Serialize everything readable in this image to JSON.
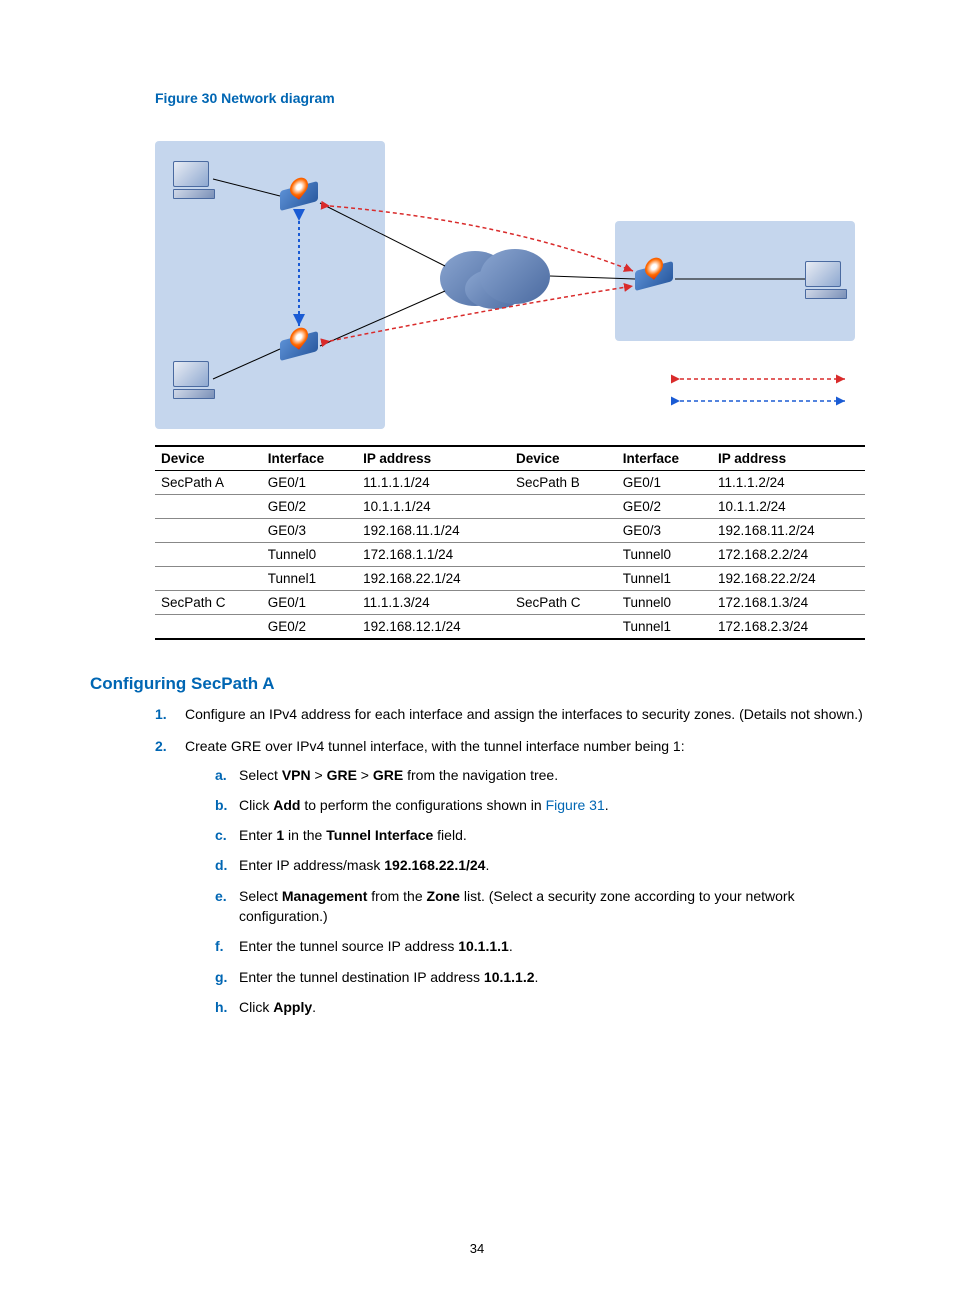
{
  "figure_caption": "Figure 30 Network diagram",
  "table": {
    "headers": [
      "Device",
      "Interface",
      "IP address",
      "Device",
      "Interface",
      "IP address"
    ],
    "rows": [
      {
        "c": [
          "SecPath A",
          "GE0/1",
          "11.1.1.1/24",
          "SecPath B",
          "GE0/1",
          "11.1.1.2/24"
        ],
        "cls": "mid-top"
      },
      {
        "c": [
          "",
          "GE0/2",
          "10.1.1.1/24",
          "",
          "GE0/2",
          "10.1.1.2/24"
        ]
      },
      {
        "c": [
          "",
          "GE0/3",
          "192.168.11.1/24",
          "",
          "GE0/3",
          "192.168.11.2/24"
        ]
      },
      {
        "c": [
          "",
          "Tunnel0",
          "172.168.1.1/24",
          "",
          "Tunnel0",
          "172.168.2.2/24"
        ]
      },
      {
        "c": [
          "",
          "Tunnel1",
          "192.168.22.1/24",
          "",
          "Tunnel1",
          "192.168.22.2/24"
        ]
      },
      {
        "c": [
          "SecPath C",
          "GE0/1",
          "11.1.1.3/24",
          "SecPath C",
          "Tunnel0",
          "172.168.1.3/24"
        ],
        "cls": "mid-top"
      },
      {
        "c": [
          "",
          "GE0/2",
          "192.168.12.1/24",
          "",
          "Tunnel1",
          "172.168.2.3/24"
        ],
        "cls": "last"
      }
    ]
  },
  "section_heading": "Configuring SecPath A",
  "steps": [
    {
      "marker": "1.",
      "text": "Configure an IPv4 address for each interface and assign the interfaces to security zones. (Details not shown.)"
    },
    {
      "marker": "2.",
      "text": "Create GRE over IPv4 tunnel interface, with the tunnel interface number being 1:",
      "sub": [
        {
          "marker": "a.",
          "prefix": "Select ",
          "bold1": "VPN",
          "mid1": " > ",
          "bold2": "GRE",
          "mid2": " > ",
          "bold3": "GRE",
          "suffix": " from the navigation tree."
        },
        {
          "marker": "b.",
          "prefix": "Click ",
          "bold1": "Add",
          "mid1": " to perform the configurations shown in ",
          "link": "Figure 31",
          "suffix": "."
        },
        {
          "marker": "c.",
          "prefix": "Enter ",
          "bold1": "1",
          "mid1": " in the ",
          "bold2": "Tunnel Interface",
          "suffix": " field."
        },
        {
          "marker": "d.",
          "prefix": "Enter IP address/mask ",
          "bold1": "192.168.22.1/24",
          "suffix": "."
        },
        {
          "marker": "e.",
          "prefix": "Select ",
          "bold1": "Management",
          "mid1": " from the ",
          "bold2": "Zone",
          "suffix": " list. (Select a security zone according to your network configuration.)"
        },
        {
          "marker": "f.",
          "prefix": "Enter the tunnel source IP address ",
          "bold1": "10.1.1.1",
          "suffix": "."
        },
        {
          "marker": "g.",
          "prefix": "Enter the tunnel destination IP address ",
          "bold1": "10.1.1.2",
          "suffix": "."
        },
        {
          "marker": "h.",
          "prefix": "Click ",
          "bold1": "Apply",
          "suffix": "."
        }
      ]
    }
  ],
  "page_number": "34"
}
